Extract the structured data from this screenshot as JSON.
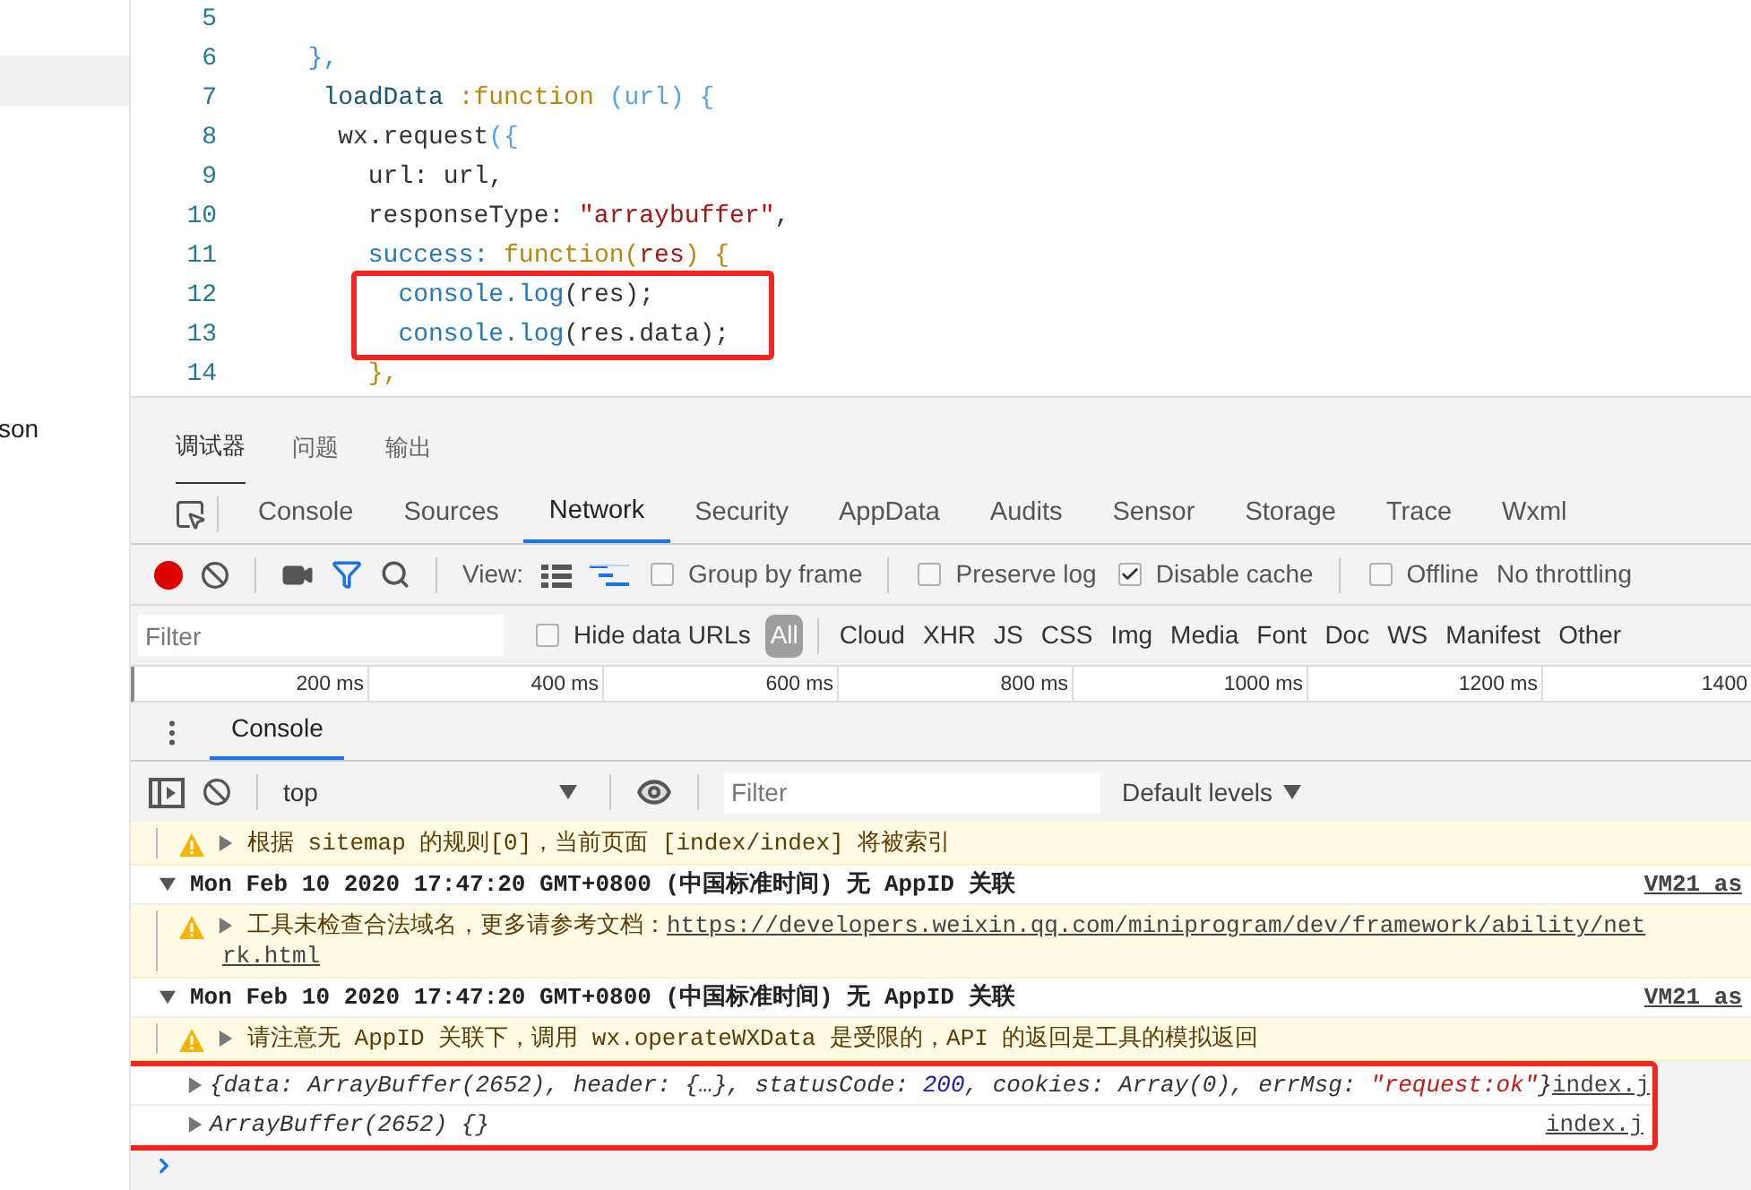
{
  "sidebar": {
    "items": [
      {
        "label": "son"
      }
    ]
  },
  "editor": {
    "lines": [
      {
        "number": "5",
        "marked": false
      },
      {
        "number": "6",
        "marked": false,
        "tokens": [
          {
            "text": "  },",
            "kind": "punct"
          }
        ]
      },
      {
        "number": "7",
        "marked": false,
        "tokens": [
          {
            "text": "   loadData ",
            "kind": "prop"
          },
          {
            "text": ":function ",
            "kind": "keyword"
          },
          {
            "text": "(url) {",
            "kind": "bracket"
          }
        ]
      },
      {
        "number": "8",
        "marked": false,
        "tokens": [
          {
            "text": "    wx.request",
            "kind": "plain"
          },
          {
            "text": "({",
            "kind": "bracket"
          }
        ]
      },
      {
        "number": "9",
        "marked": false,
        "tokens": [
          {
            "text": "      url: url,",
            "kind": "plain"
          }
        ]
      },
      {
        "number": "10",
        "marked": false,
        "tokens": [
          {
            "text": "      responseType: ",
            "kind": "plain"
          },
          {
            "text": "\"arraybuffer\"",
            "kind": "string"
          },
          {
            "text": ",",
            "kind": "plain"
          }
        ]
      },
      {
        "number": "11",
        "marked": false,
        "tokens": [
          {
            "text": "      success: ",
            "kind": "prop2"
          },
          {
            "text": "function(",
            "kind": "keyword"
          },
          {
            "text": "res",
            "kind": "string"
          },
          {
            "text": ") {",
            "kind": "keyword"
          }
        ]
      },
      {
        "number": "12",
        "marked": true,
        "tokens": [
          {
            "text": "        console.log",
            "kind": "prop2"
          },
          {
            "text": "(res);",
            "kind": "plain"
          }
        ]
      },
      {
        "number": "13",
        "marked": true,
        "tokens": [
          {
            "text": "        console.log",
            "kind": "prop2"
          },
          {
            "text": "(res.data);",
            "kind": "plain"
          }
        ]
      },
      {
        "number": "14",
        "marked": false,
        "tokens": [
          {
            "text": "      },",
            "kind": "keyword"
          }
        ]
      }
    ]
  },
  "devtools": {
    "panels": [
      {
        "label": "调试器",
        "selected": true
      },
      {
        "label": "问题",
        "selected": false
      },
      {
        "label": "输出",
        "selected": false
      }
    ],
    "tabs": [
      {
        "label": "Console",
        "selected": false
      },
      {
        "label": "Sources",
        "selected": false
      },
      {
        "label": "Network",
        "selected": true
      },
      {
        "label": "Security",
        "selected": false
      },
      {
        "label": "AppData",
        "selected": false
      },
      {
        "label": "Audits",
        "selected": false
      },
      {
        "label": "Sensor",
        "selected": false
      },
      {
        "label": "Storage",
        "selected": false
      },
      {
        "label": "Trace",
        "selected": false
      },
      {
        "label": "Wxml",
        "selected": false
      }
    ],
    "toolbar": {
      "recording": true,
      "view_label": "View:",
      "checkboxes": [
        {
          "label": "Group by frame",
          "checked": false
        },
        {
          "label": "Preserve log",
          "checked": false
        },
        {
          "label": "Disable cache",
          "checked": true
        },
        {
          "label": "Offline",
          "checked": false
        }
      ],
      "throttling": "No throttling"
    },
    "filter": {
      "placeholder": "Filter",
      "hide_data_urls": {
        "label": "Hide data URLs",
        "checked": false
      },
      "types": [
        {
          "label": "All",
          "selected": true
        },
        {
          "label": "Cloud",
          "selected": false
        },
        {
          "label": "XHR",
          "selected": false
        },
        {
          "label": "JS",
          "selected": false
        },
        {
          "label": "CSS",
          "selected": false
        },
        {
          "label": "Img",
          "selected": false
        },
        {
          "label": "Media",
          "selected": false
        },
        {
          "label": "Font",
          "selected": false
        },
        {
          "label": "Doc",
          "selected": false
        },
        {
          "label": "WS",
          "selected": false
        },
        {
          "label": "Manifest",
          "selected": false
        },
        {
          "label": "Other",
          "selected": false
        }
      ]
    },
    "timeline": {
      "ticks": [
        "200 ms",
        "400 ms",
        "600 ms",
        "800 ms",
        "1000 ms",
        "1200 ms",
        "1400"
      ]
    },
    "drawer": {
      "tabs": [
        {
          "label": "Console",
          "selected": true
        }
      ]
    },
    "console": {
      "context": "top",
      "filter_placeholder": "Filter",
      "levels": "Default levels",
      "messages": [
        {
          "kind": "warning",
          "marked": false,
          "text": "根据 sitemap 的规则[0]，当前页面 [index/index] 将被索引"
        },
        {
          "kind": "group",
          "marked": false,
          "text": "Mon Feb 10 2020 17:47:20 GMT+0800 (中国标准时间) 无 AppID 关联",
          "source": "VM21 as"
        },
        {
          "kind": "warning",
          "marked": false,
          "text": "工具未检查合法域名，更多请参考文档：",
          "link": "https://developers.weixin.qq.com/miniprogram/dev/framework/ability/net",
          "link_rest": "rk.html"
        },
        {
          "kind": "group",
          "marked": false,
          "text": "Mon Feb 10 2020 17:47:20 GMT+0800 (中国标准时间) 无 AppID 关联",
          "source": "VM21 as"
        },
        {
          "kind": "warning",
          "marked": false,
          "text": "请注意无 AppID 关联下，调用 wx.operateWXData 是受限的，API 的返回是工具的模拟返回"
        },
        {
          "kind": "log",
          "marked": true,
          "source": "index.j",
          "tokens": [
            {
              "text": "{data: ArrayBuffer(2652), header: {…}, statusCode: ",
              "kind": "plain"
            },
            {
              "text": "200",
              "kind": "number"
            },
            {
              "text": ", cookies: Array(0), errMsg: ",
              "kind": "plain"
            },
            {
              "text": "\"request:ok\"",
              "kind": "string"
            },
            {
              "text": "}",
              "kind": "plain"
            }
          ]
        },
        {
          "kind": "log",
          "marked": true,
          "source": "index.j",
          "tokens": [
            {
              "text": "ArrayBuffer(2652) {}",
              "kind": "plain"
            }
          ]
        }
      ]
    }
  }
}
